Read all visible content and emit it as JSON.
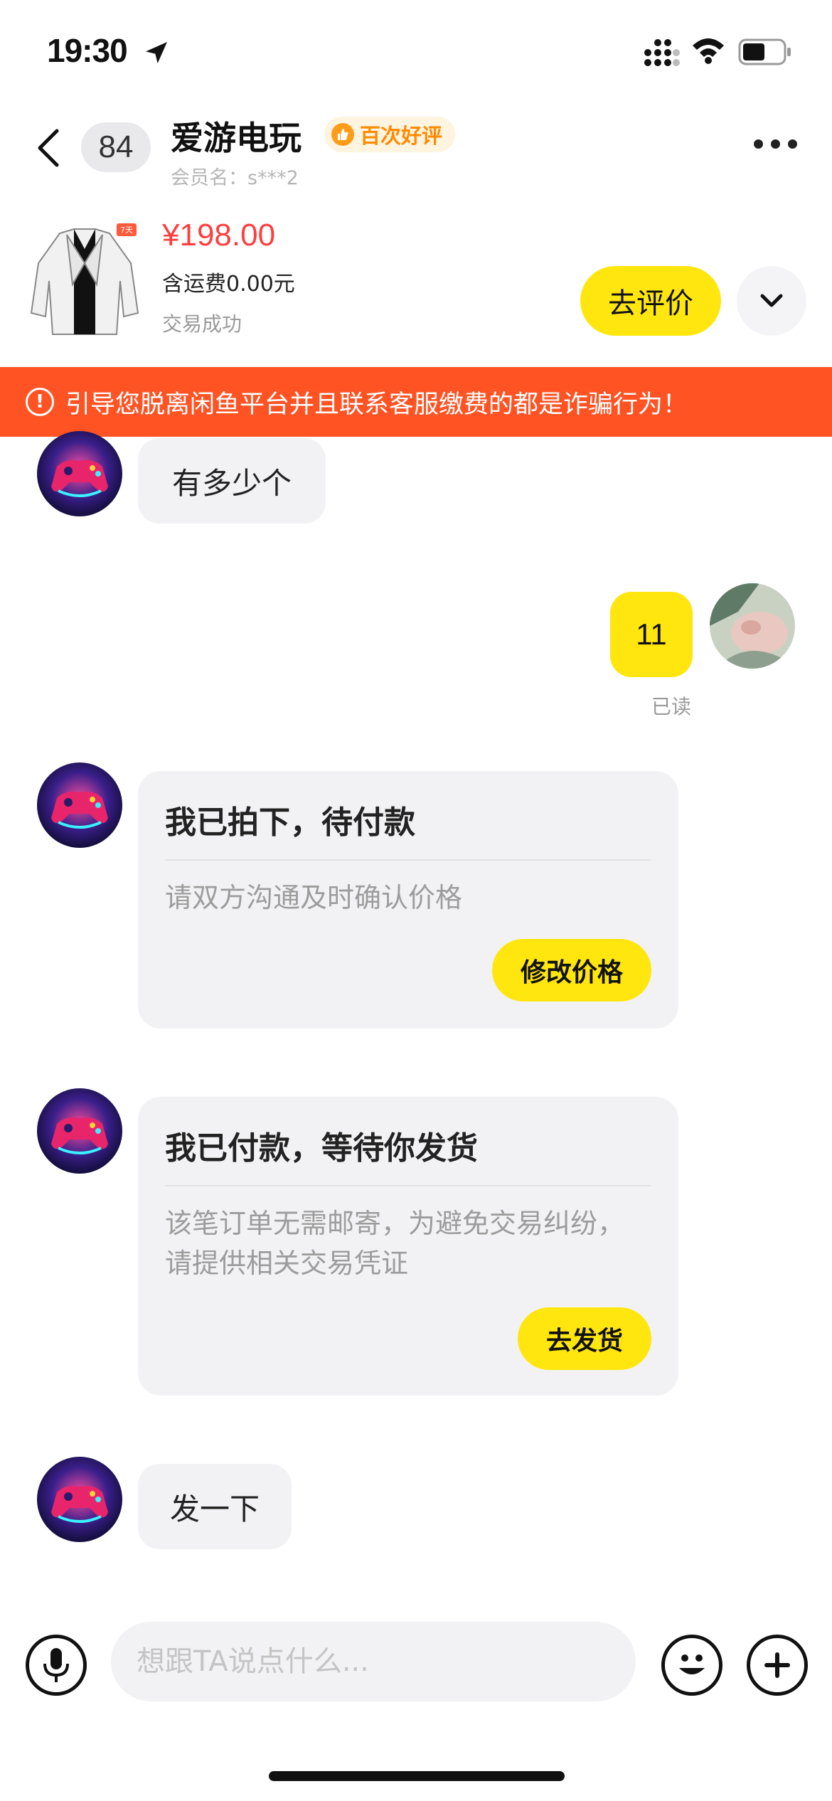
{
  "status_bar": {
    "time": "19:30"
  },
  "header": {
    "unread_count": "84",
    "shop_name": "爱游电玩",
    "badge": "百次好评",
    "member_name": "会员名：s***2"
  },
  "product": {
    "price": "¥198.00",
    "shipping": "含运费0.00元",
    "status": "交易成功",
    "review_button": "去评价",
    "tag": "7天"
  },
  "warning": {
    "icon": "!",
    "text": "引导您脱离闲鱼平台并且联系客服缴费的都是诈骗行为！"
  },
  "messages": [
    {
      "from": "seller",
      "text": "有多少个"
    },
    {
      "from": "me",
      "text": "11",
      "read": "已读"
    },
    {
      "from": "seller",
      "card_title": "我已拍下，待付款",
      "card_desc": "请双方沟通及时确认价格",
      "card_button": "修改价格"
    },
    {
      "from": "seller",
      "card_title": "我已付款，等待你发货",
      "card_desc": "该笔订单无需邮寄，为避免交易纠纷，请提供相关交易凭证",
      "card_button": "去发货"
    },
    {
      "from": "seller",
      "text": "发一下"
    }
  ],
  "input": {
    "placeholder": "想跟TA说点什么..."
  },
  "colors": {
    "accent": "#ffe60f",
    "warning": "#ff5324",
    "price": "#ff3e3e",
    "badge": "#ff8a00"
  },
  "icons": [
    "location-arrow-icon",
    "signal-icon",
    "wifi-icon",
    "battery-icon",
    "back-icon",
    "thumbs-up-icon",
    "more-icon",
    "chevron-down-icon",
    "warning-icon",
    "mic-icon",
    "emoji-icon",
    "plus-icon"
  ]
}
